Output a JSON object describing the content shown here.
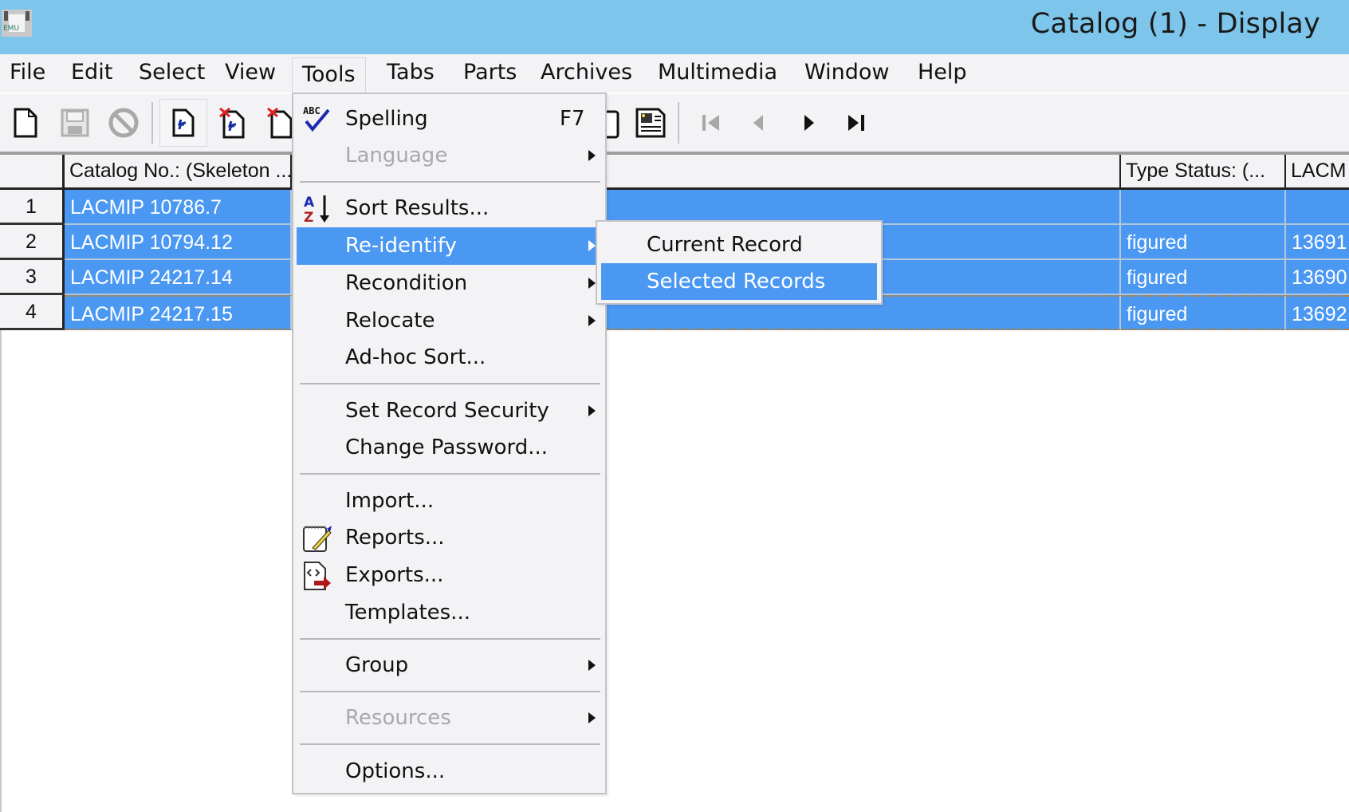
{
  "window": {
    "title": "Catalog (1) - Display",
    "app_icon": "emu-app-icon"
  },
  "menubar": {
    "items": [
      {
        "label": "File"
      },
      {
        "label": "Edit"
      },
      {
        "label": "Select"
      },
      {
        "label": "View"
      },
      {
        "label": "Tools",
        "open": true
      },
      {
        "label": "Tabs"
      },
      {
        "label": "Parts"
      },
      {
        "label": "Archives"
      },
      {
        "label": "Multimedia"
      },
      {
        "label": "Window"
      },
      {
        "label": "Help"
      }
    ]
  },
  "toolbar": {
    "buttons": [
      {
        "icon": "new-document-icon",
        "enabled": true
      },
      {
        "icon": "save-icon",
        "enabled": false
      },
      {
        "icon": "cancel-icon",
        "enabled": false
      },
      {
        "icon": "display-record-icon",
        "enabled": true,
        "pressed": true
      },
      {
        "icon": "delete-record-icon",
        "enabled": true
      },
      {
        "icon": "delete-document-icon",
        "enabled": true
      },
      {
        "icon": "clipboard-icon",
        "enabled": true
      },
      {
        "icon": "report-view-icon",
        "enabled": true
      },
      {
        "icon": "first-record-icon",
        "enabled": false
      },
      {
        "icon": "previous-record-icon",
        "enabled": false
      },
      {
        "icon": "next-record-icon",
        "enabled": true
      },
      {
        "icon": "last-record-icon",
        "enabled": true
      }
    ]
  },
  "grid": {
    "columns": [
      {
        "label": "Catalog No.: (Skeleton ..."
      },
      {
        "label": ""
      },
      {
        "label": "Type Status: (..."
      },
      {
        "label": "LACM"
      }
    ],
    "rows": [
      {
        "num": "1",
        "catalog_no": "LACMIP 10786.7",
        "hidden": "",
        "type_status": "",
        "lacm": ""
      },
      {
        "num": "2",
        "catalog_no": "LACMIP 10794.12",
        "hidden": "",
        "type_status": "figured",
        "lacm": "13691"
      },
      {
        "num": "3",
        "catalog_no": "LACMIP 24217.14",
        "hidden": "",
        "type_status": "figured",
        "lacm": "13690"
      },
      {
        "num": "4",
        "catalog_no": "LACMIP 24217.15",
        "hidden": "",
        "type_status": "figured",
        "lacm": "13692",
        "current": true
      }
    ],
    "selection_color": "#4a98f2"
  },
  "tools_menu": {
    "items": [
      {
        "label": "Spelling",
        "accel": "F7",
        "icon": "spelling-check-icon"
      },
      {
        "label": "Language",
        "submenu": true,
        "disabled": true
      },
      {
        "label": "Sort Results...",
        "icon": "sort-az-icon"
      },
      {
        "label": "Re-identify",
        "submenu": true,
        "highlighted": true
      },
      {
        "label": "Recondition",
        "submenu": true
      },
      {
        "label": "Relocate",
        "submenu": true
      },
      {
        "label": "Ad-hoc Sort..."
      },
      {
        "label": "Set Record Security",
        "submenu": true
      },
      {
        "label": "Change Password..."
      },
      {
        "label": "Import..."
      },
      {
        "label": "Reports...",
        "icon": "reports-icon"
      },
      {
        "label": "Exports...",
        "icon": "exports-icon"
      },
      {
        "label": "Templates..."
      },
      {
        "label": "Group",
        "submenu": true
      },
      {
        "label": "Resources",
        "submenu": true,
        "disabled": true
      },
      {
        "label": "Options..."
      }
    ]
  },
  "reidentify_submenu": {
    "items": [
      {
        "label": "Current Record"
      },
      {
        "label": "Selected Records",
        "highlighted": true
      }
    ]
  }
}
